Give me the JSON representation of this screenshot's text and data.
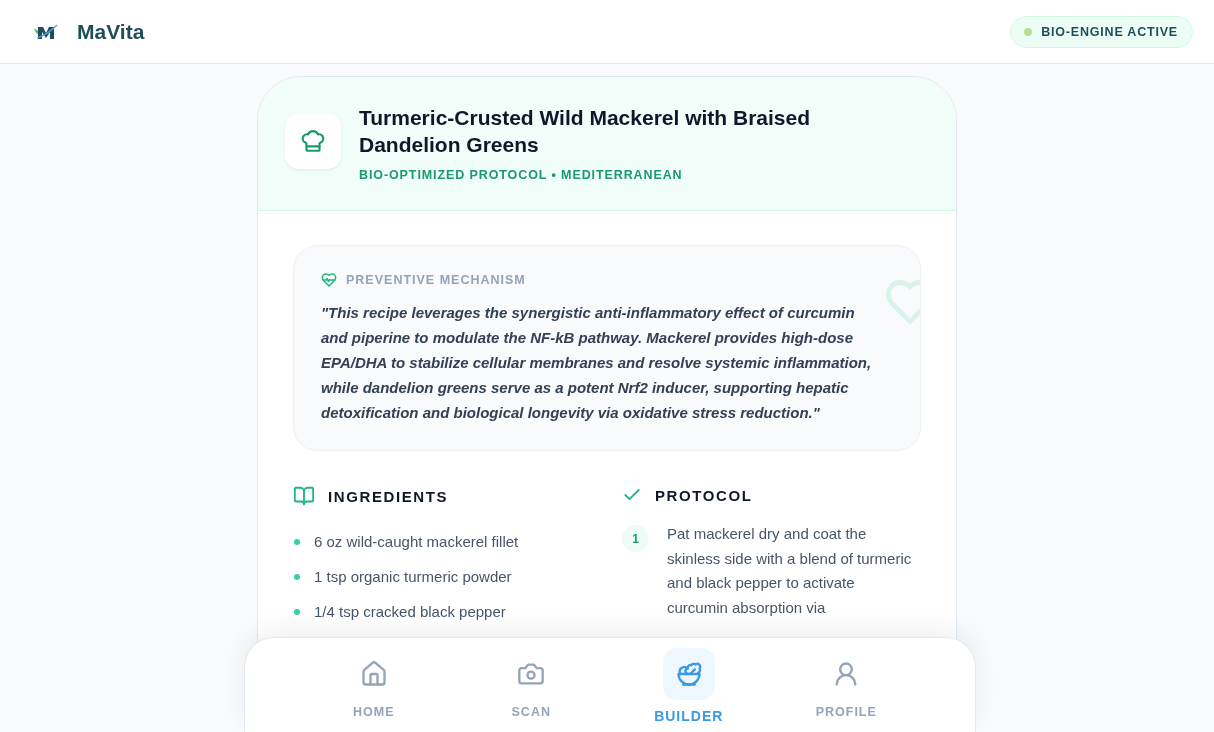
{
  "app": {
    "name": "MaVita",
    "status": {
      "label": "BIO-ENGINE ACTIVE",
      "active": true
    }
  },
  "recipe": {
    "title": "Turmeric-Crusted Wild Mackerel with Braised Dandelion Greens",
    "subtitle": "BIO-OPTIMIZED PROTOCOL • MEDITERRANEAN"
  },
  "mechanism": {
    "heading": "PREVENTIVE MECHANISM",
    "text": "\"This recipe leverages the synergistic anti-inflammatory effect of curcumin and piperine to modulate the NF-kB pathway. Mackerel provides high-dose EPA/DHA to stabilize cellular membranes and resolve systemic inflammation, while dandelion greens serve as a potent Nrf2 inducer, supporting hepatic detoxification and biological longevity via oxidative stress reduction.\""
  },
  "ingredients": {
    "heading": "INGREDIENTS",
    "items": [
      "6 oz wild-caught mackerel fillet",
      "1 tsp organic turmeric powder",
      "1/4 tsp cracked black pepper"
    ]
  },
  "protocol": {
    "heading": "PROTOCOL",
    "steps": [
      {
        "number": "1",
        "text": "Pat mackerel dry and coat the skinless side with a blend of turmeric and black pepper to activate curcumin absorption via"
      }
    ]
  },
  "nav": [
    {
      "kind": "home",
      "label": "HOME",
      "selected": false
    },
    {
      "kind": "scan",
      "label": "SCAN",
      "selected": false
    },
    {
      "kind": "builder",
      "label": "BUILDER",
      "selected": true
    },
    {
      "kind": "profile",
      "label": "PROFILE",
      "selected": false
    }
  ]
}
